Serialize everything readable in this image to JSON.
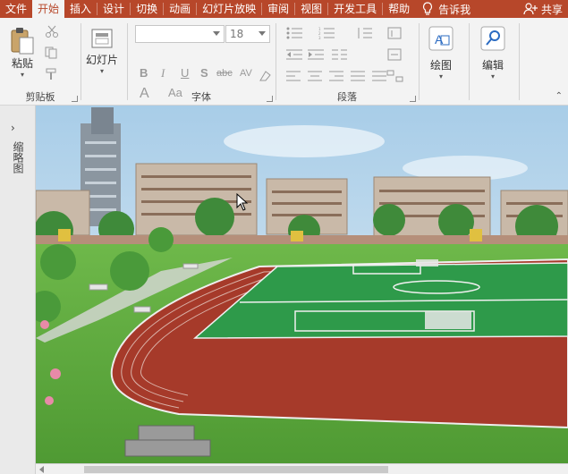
{
  "tabs": [
    "文件",
    "开始",
    "插入",
    "设计",
    "切换",
    "动画",
    "幻灯片放映",
    "审阅",
    "视图",
    "开发工具",
    "帮助"
  ],
  "active_tab": 1,
  "tell_me": "告诉我",
  "share": "共享",
  "clipboard": {
    "paste": "粘贴",
    "label": "剪贴板"
  },
  "slides": {
    "new_slide": "幻灯片",
    "label": ""
  },
  "font": {
    "name": "",
    "size": "18",
    "label": "字体",
    "bold": "B",
    "italic": "I",
    "underline": "U",
    "shadow": "S",
    "strike": "abc",
    "spacing": "AV",
    "case": "Aa",
    "color": "A"
  },
  "paragraph": {
    "label": "段落"
  },
  "drawing": {
    "label": "绘图"
  },
  "editing": {
    "label": "编辑"
  },
  "pane": {
    "label": "缩略图"
  },
  "colors": {
    "accent": "#b7472a",
    "ribbon_bg": "#f3f3f3",
    "grass": "#5aa83a",
    "track": "#a63a2a"
  }
}
